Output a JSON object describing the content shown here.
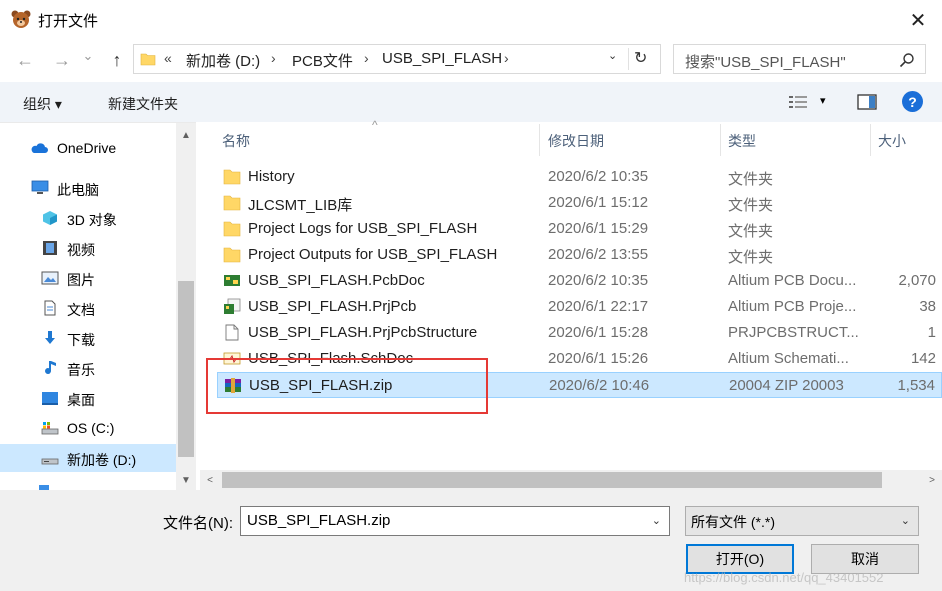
{
  "window": {
    "title": "打开文件",
    "close_glyph": "✕"
  },
  "nav_buttons": {
    "back": "←",
    "forward": "→",
    "dropdown": "⌄",
    "up": "↑"
  },
  "address": {
    "overflow": "«",
    "crumbs": [
      "新加卷 (D:)",
      "PCB文件",
      "USB_SPI_FLASH"
    ],
    "separator": "›",
    "dropdown": "⌄",
    "refresh": "↻"
  },
  "search": {
    "placeholder": "搜索\"USB_SPI_FLASH\""
  },
  "toolbar": {
    "organize": "组织 ▾",
    "new_folder": "新建文件夹",
    "view_dropdown": "▾",
    "help": "?"
  },
  "nav": {
    "items": [
      {
        "label": "OneDrive",
        "icon": "cloud-icon"
      },
      {
        "label": "此电脑",
        "icon": "pc-icon"
      },
      {
        "label": "3D 对象",
        "icon": "cube-icon"
      },
      {
        "label": "视频",
        "icon": "video-icon"
      },
      {
        "label": "图片",
        "icon": "picture-icon"
      },
      {
        "label": "文档",
        "icon": "document-icon"
      },
      {
        "label": "下载",
        "icon": "download-icon"
      },
      {
        "label": "音乐",
        "icon": "music-icon"
      },
      {
        "label": "桌面",
        "icon": "desktop-icon"
      },
      {
        "label": "OS (C:)",
        "icon": "drive-c-icon"
      },
      {
        "label": "新加卷 (D:)",
        "icon": "drive-d-icon"
      }
    ],
    "scroll_up": "▲",
    "scroll_down": "▼"
  },
  "columns": {
    "name": "名称",
    "date": "修改日期",
    "type": "类型",
    "size": "大小",
    "sort_caret": "^"
  },
  "files": [
    {
      "name": "History",
      "date": "2020/6/2 10:35",
      "type": "文件夹",
      "size": "",
      "icon": "folder-icon"
    },
    {
      "name": "JLCSMT_LIB库",
      "date": "2020/6/1 15:12",
      "type": "文件夹",
      "size": "",
      "icon": "folder-icon"
    },
    {
      "name": "Project Logs for USB_SPI_FLASH",
      "date": "2020/6/1 15:29",
      "type": "文件夹",
      "size": "",
      "icon": "folder-icon"
    },
    {
      "name": "Project Outputs for USB_SPI_FLASH",
      "date": "2020/6/2 13:55",
      "type": "文件夹",
      "size": "",
      "icon": "folder-icon"
    },
    {
      "name": "USB_SPI_FLASH.PcbDoc",
      "date": "2020/6/2 10:35",
      "type": "Altium PCB Docu...",
      "size": "2,070",
      "icon": "pcbdoc-icon"
    },
    {
      "name": "USB_SPI_FLASH.PrjPcb",
      "date": "2020/6/1 22:17",
      "type": "Altium PCB Proje...",
      "size": "38",
      "icon": "prjpcb-icon"
    },
    {
      "name": "USB_SPI_FLASH.PrjPcbStructure",
      "date": "2020/6/1 15:28",
      "type": "PRJPCBSTRUCT...",
      "size": "1",
      "icon": "file-icon"
    },
    {
      "name": "USB_SPI_Flash.SchDoc",
      "date": "2020/6/1 15:26",
      "type": "Altium Schemati...",
      "size": "142",
      "icon": "schdoc-icon"
    },
    {
      "name": "USB_SPI_FLASH.zip",
      "date": "2020/6/2 10:46",
      "type": "20004 ZIP 20003",
      "size": "1,534",
      "icon": "zip-icon"
    }
  ],
  "hscroll": {
    "left": "<",
    "right": ">"
  },
  "footer": {
    "filename_label": "文件名(N):",
    "filename_value": "USB_SPI_FLASH.zip",
    "filetype_value": "所有文件 (*.*)",
    "dropdown": "⌄",
    "open_label": "打开(O)",
    "cancel_label": "取消"
  },
  "watermark": "https://blog.csdn.net/qq_43401552",
  "colors": {
    "accent": "#0078d7",
    "selection": "#cce8ff",
    "highlight_box": "#e53935",
    "folder": "#ffd766"
  }
}
